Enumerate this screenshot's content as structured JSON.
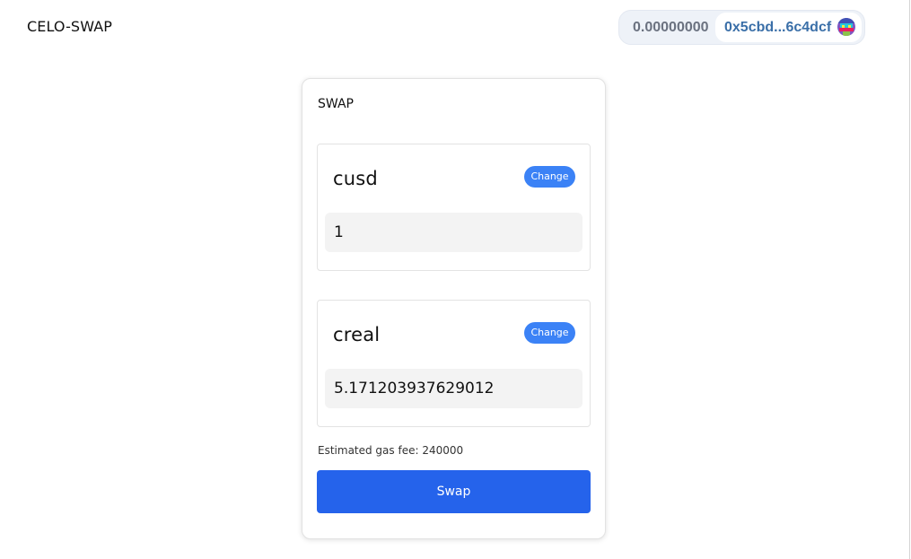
{
  "header": {
    "brand": "CELO-SWAP",
    "wallet": {
      "balance": "0.00000000",
      "address": "0x5cbd...6c4dcf",
      "avatar_icon": "identicon-avatar"
    }
  },
  "swap": {
    "title": "SWAP",
    "from": {
      "token": "cusd",
      "change_label": "Change",
      "amount": "1"
    },
    "to": {
      "token": "creal",
      "change_label": "Change",
      "amount": "5.171203937629012"
    },
    "gas_fee": "Estimated gas fee: 240000",
    "swap_label": "Swap"
  },
  "colors": {
    "accent": "#2563eb",
    "change_button": "#3b82f6",
    "address": "#3a6fa8"
  }
}
